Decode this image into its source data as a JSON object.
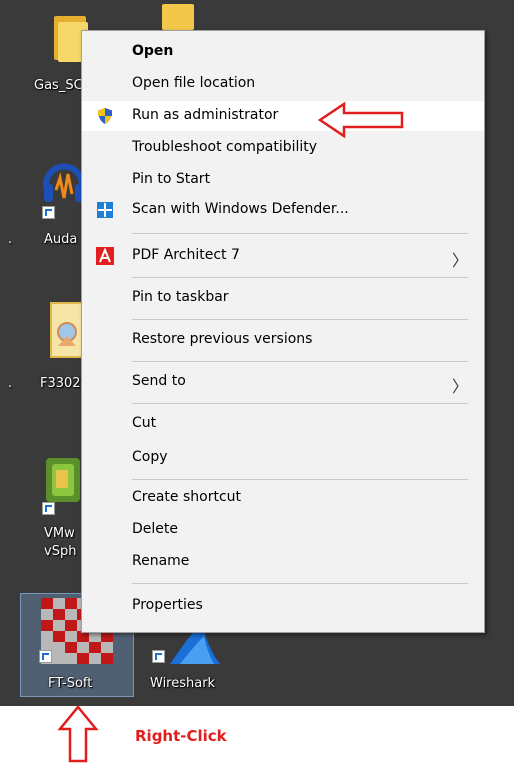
{
  "desktop": {
    "icons": [
      {
        "label": "Gas_SC"
      },
      {
        "label": "Auda"
      },
      {
        "label": "F3302"
      },
      {
        "label_line1": "VMw",
        "label_line2": "vSph"
      },
      {
        "label": "FT-Soft"
      },
      {
        "label": "Wireshark"
      }
    ],
    "side_marks": [
      ".",
      "."
    ]
  },
  "context_menu": {
    "items": [
      {
        "label": "Open",
        "bold": true
      },
      {
        "label": "Open file location"
      },
      {
        "label": "Run as administrator",
        "icon": "uac-shield-icon",
        "highlighted": true
      },
      {
        "label": "Troubleshoot compatibility"
      },
      {
        "label": "Pin to Start"
      },
      {
        "label": "Scan with Windows Defender...",
        "icon": "windows-defender-icon"
      },
      {
        "label": "PDF Architect 7",
        "icon": "pdf-architect-icon",
        "submenu": true
      },
      {
        "label": "Pin to taskbar"
      },
      {
        "label": "Restore previous versions"
      },
      {
        "label": "Send to",
        "submenu": true
      },
      {
        "label": "Cut"
      },
      {
        "label": "Copy"
      },
      {
        "label": "Create shortcut"
      },
      {
        "label": "Delete"
      },
      {
        "label": "Rename"
      },
      {
        "label": "Properties"
      }
    ],
    "submenu_glyph": "〉"
  },
  "annotations": {
    "right_click_label": "Right-Click",
    "arrow_color": "#e11d1d"
  },
  "colors": {
    "desktop_bg": "#3a3a3a",
    "menu_bg": "#f2f2f2",
    "accent_red": "#e11d1d"
  }
}
